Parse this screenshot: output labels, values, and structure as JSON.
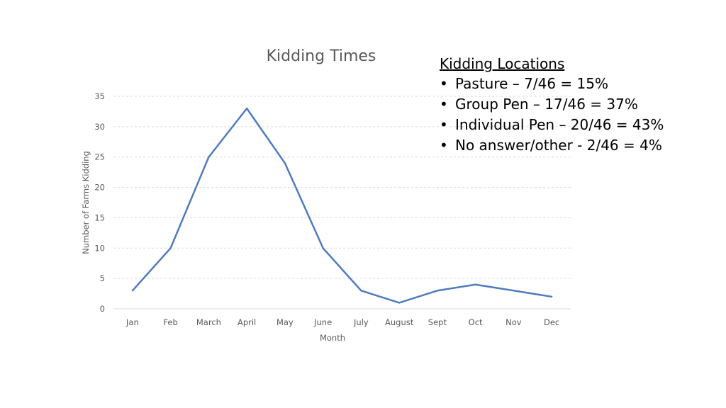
{
  "chart_data": {
    "type": "line",
    "title": "Kidding Times",
    "xlabel": "Month",
    "ylabel": "Number of Farms Kidding",
    "categories": [
      "Jan",
      "Feb",
      "March",
      "April",
      "May",
      "June",
      "July",
      "August",
      "Sept",
      "Oct",
      "Nov",
      "Dec"
    ],
    "series": [
      {
        "name": "Farms Kidding",
        "color": "#4f7bbf",
        "values": [
          3,
          10,
          25,
          33,
          24,
          10,
          3,
          1,
          3,
          4,
          3,
          2
        ]
      }
    ],
    "ylim": [
      0,
      35
    ],
    "yticks": [
      0,
      5,
      10,
      15,
      20,
      25,
      30,
      35
    ],
    "grid": true,
    "legend": "none"
  },
  "notes": {
    "heading": "Kidding Locations",
    "bullet_glyph": "•",
    "items": [
      "Pasture – 7/46 = 15%",
      "Group Pen – 17/46 = 37%",
      "Individual Pen – 20/46 = 43%",
      "No answer/other - 2/46 = 4%"
    ]
  }
}
